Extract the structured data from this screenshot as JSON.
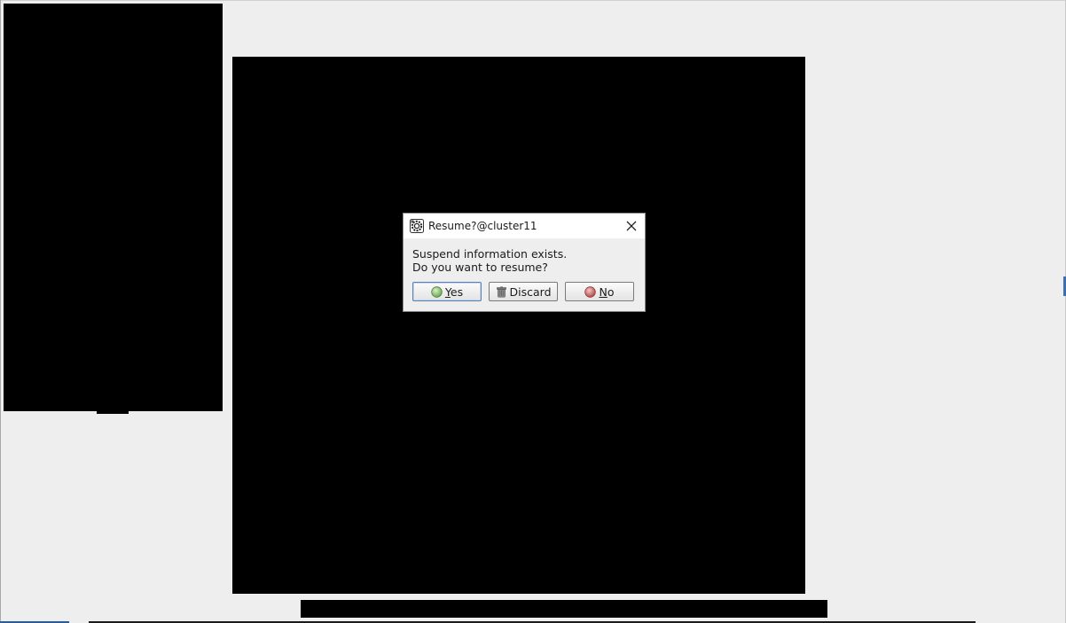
{
  "dialog": {
    "title": "Resume?@cluster11",
    "message_line1": "Suspend information exists.",
    "message_line2": "Do you want to resume?",
    "buttons": {
      "yes": {
        "mnemonic": "Y",
        "rest": "es"
      },
      "discard": {
        "label": "Discard"
      },
      "no": {
        "mnemonic": "N",
        "rest": "o"
      }
    },
    "icons": {
      "title": "app-gear-icon",
      "close": "close-icon",
      "yes": "green-circle-icon",
      "discard": "trash-can-icon",
      "no": "red-circle-icon"
    }
  },
  "colors": {
    "background": "#eeeeee",
    "panel": "#000000",
    "yes_icon": "#7fbf5f",
    "no_icon": "#c85a5a",
    "default_button_border": "#5a7fb3"
  }
}
